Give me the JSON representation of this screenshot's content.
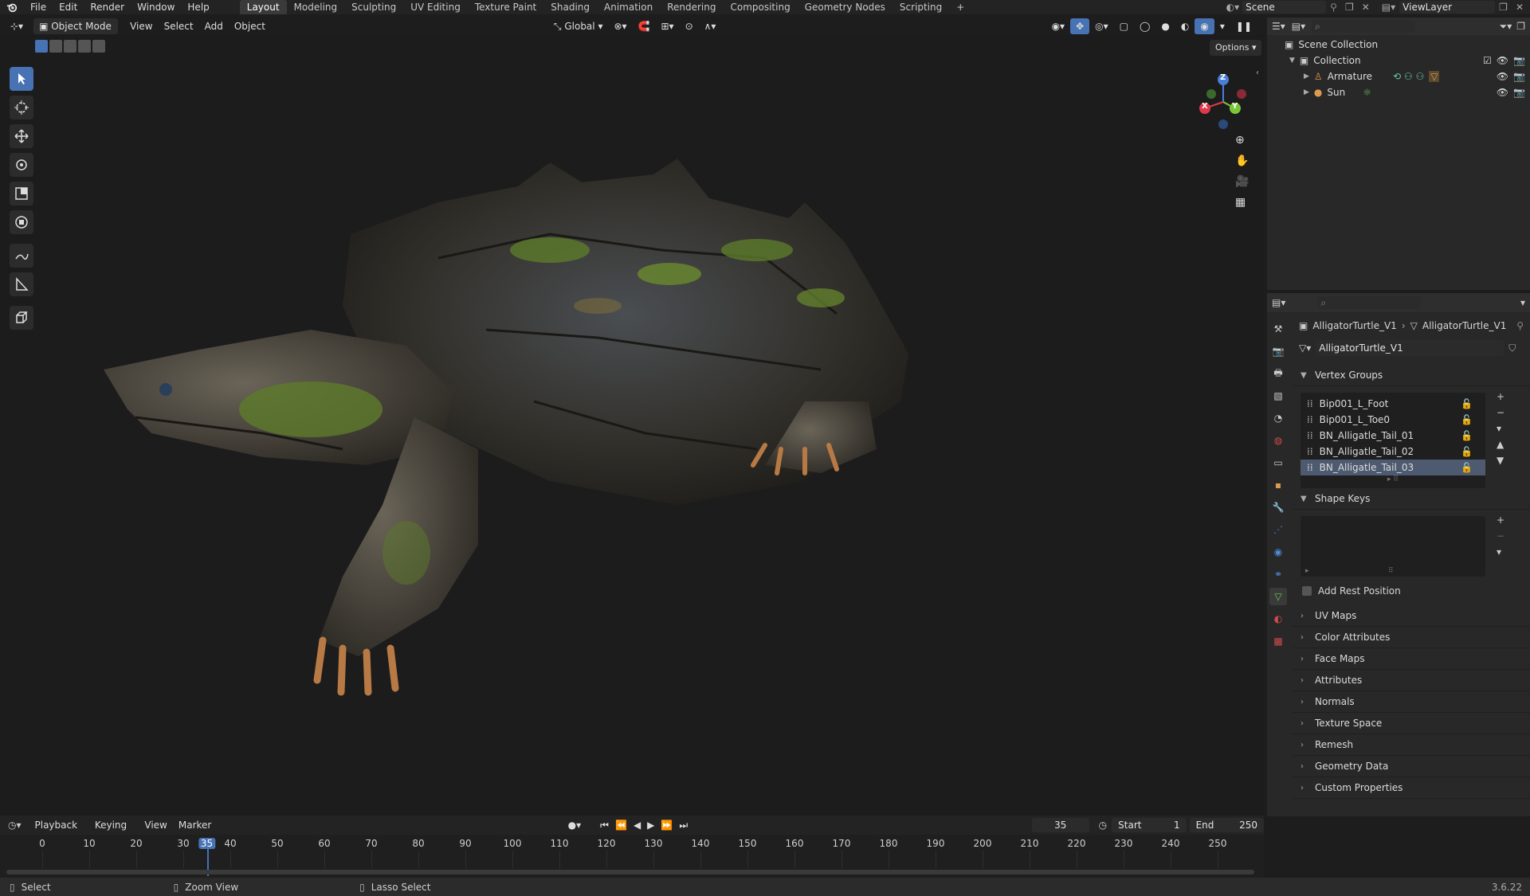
{
  "menu": {
    "items": [
      "File",
      "Edit",
      "Render",
      "Window",
      "Help"
    ]
  },
  "workspaces": {
    "tabs": [
      "Layout",
      "Modeling",
      "Sculpting",
      "UV Editing",
      "Texture Paint",
      "Shading",
      "Animation",
      "Rendering",
      "Compositing",
      "Geometry Nodes",
      "Scripting"
    ],
    "add": "+"
  },
  "top_right": {
    "scene": "Scene",
    "view_layer": "ViewLayer"
  },
  "viewport_header": {
    "mode": "Object Mode",
    "menus": [
      "View",
      "Select",
      "Add",
      "Object"
    ],
    "transform": "Global",
    "options": "Options"
  },
  "outliner": {
    "scene_collection": "Scene Collection",
    "collection": "Collection",
    "items": [
      "Armature",
      "Sun"
    ]
  },
  "properties": {
    "breadcrumb_1": "AlligatorTurtle_V1",
    "breadcrumb_2": "AlligatorTurtle_V1",
    "data_name": "AlligatorTurtle_V1",
    "vertex_groups_title": "Vertex Groups",
    "vertex_groups": [
      "Bip001_L_Foot",
      "Bip001_L_Toe0",
      "BN_Alligatle_Tail_01",
      "BN_Alligatle_Tail_02",
      "BN_Alligatle_Tail_03"
    ],
    "selected_vertex_group": 4,
    "shape_keys_title": "Shape Keys",
    "add_rest_position": "Add Rest Position",
    "collapsed_panels": [
      "UV Maps",
      "Color Attributes",
      "Face Maps",
      "Attributes",
      "Normals",
      "Texture Space",
      "Remesh",
      "Geometry Data",
      "Custom Properties"
    ]
  },
  "timeline": {
    "menus": [
      "Playback",
      "Keying",
      "View",
      "Marker"
    ],
    "current_frame": "35",
    "start_label": "Start",
    "start_value": "1",
    "end_label": "End",
    "end_value": "250",
    "ticks": [
      "0",
      "10",
      "20",
      "30",
      "35",
      "40",
      "50",
      "60",
      "70",
      "80",
      "90",
      "100",
      "110",
      "120",
      "130",
      "140",
      "150",
      "160",
      "170",
      "180",
      "190",
      "200",
      "210",
      "220",
      "230",
      "240",
      "250"
    ]
  },
  "status": {
    "select": "Select",
    "zoom": "Zoom View",
    "lasso": "Lasso Select",
    "version": "3.6.22"
  },
  "gizmo": {
    "z": "Z",
    "y": "Y",
    "x": "X"
  },
  "colors": {
    "accent": "#4772b3",
    "header": "#232323",
    "panel": "#282828",
    "selected_row": "#4d5a70"
  }
}
